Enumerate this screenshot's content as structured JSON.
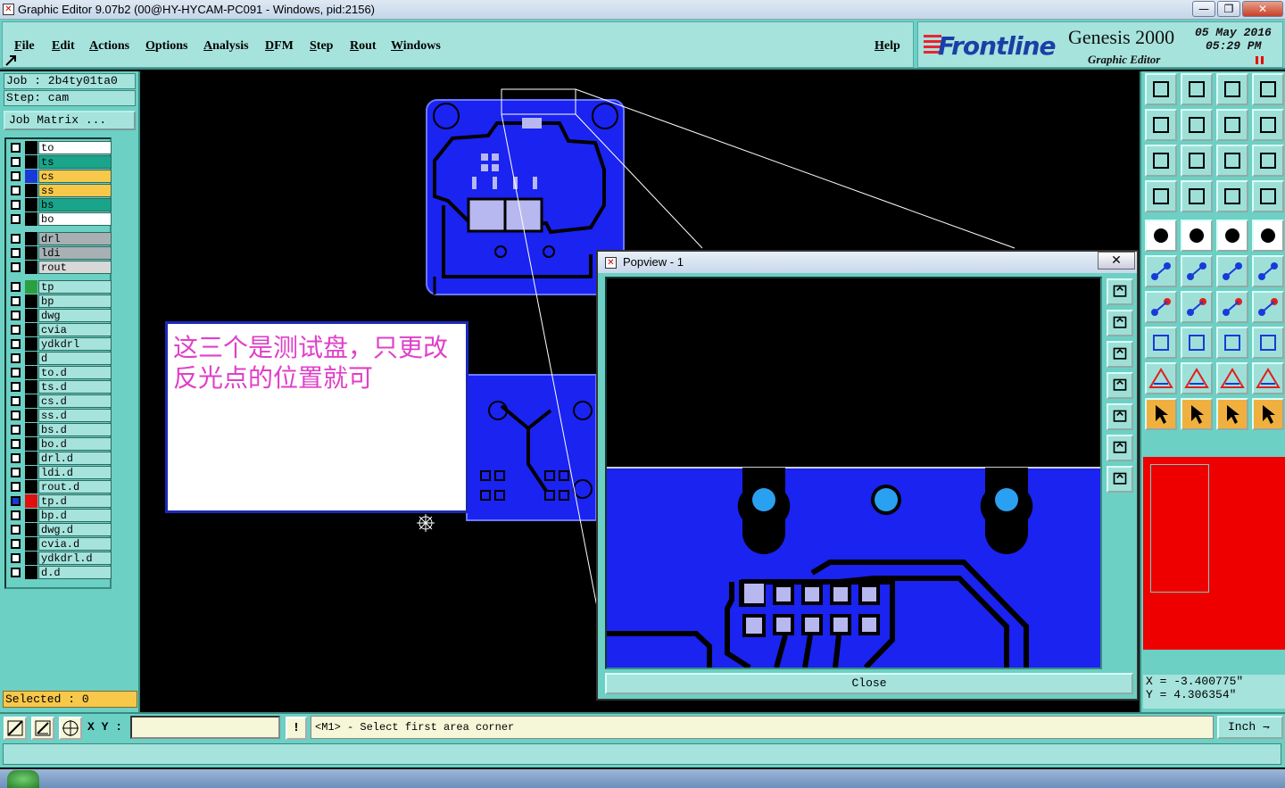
{
  "window": {
    "title": "Graphic Editor 9.07b2 (00@HY-HYCAM-PC091 - Windows, pid:2156)",
    "min": "—",
    "max": "❐",
    "close": "✕"
  },
  "menu": {
    "file": "File",
    "edit": "Edit",
    "actions": "Actions",
    "options": "Options",
    "analysis": "Analysis",
    "dfm": "DFM",
    "step": "Step",
    "rout": "Rout",
    "windows": "Windows",
    "help": "Help"
  },
  "logo": {
    "brand": "Frontline",
    "product": "Genesis 2000",
    "subtitle": "Graphic Editor",
    "date": "05 May 2016",
    "time": "05:29 PM"
  },
  "job": {
    "job": "Job : 2b4ty01ta0",
    "step": "Step: cam",
    "matrix": "Job Matrix ..."
  },
  "layers": [
    {
      "name": "to",
      "color": "#ffffff",
      "swatch": "#000000",
      "checked": false
    },
    {
      "name": "ts",
      "color": "#1aa58a",
      "swatch": "#000000",
      "checked": false
    },
    {
      "name": "cs",
      "color": "#f7c84a",
      "swatch": "#1a3ad8",
      "checked": false
    },
    {
      "name": "ss",
      "color": "#f7c84a",
      "swatch": "#000000",
      "checked": false
    },
    {
      "name": "bs",
      "color": "#1aa58a",
      "swatch": "#000000",
      "checked": false
    },
    {
      "name": "bo",
      "color": "#ffffff",
      "swatch": "#000000",
      "checked": false
    },
    {
      "name": "drl",
      "color": "#a8b0b4",
      "swatch": "#000000",
      "checked": false
    },
    {
      "name": "ldi",
      "color": "#a8b0b4",
      "swatch": "#000000",
      "checked": false
    },
    {
      "name": "rout",
      "color": "#d8d8d8",
      "swatch": "#000000",
      "checked": false
    },
    {
      "name": "tp",
      "color": "#a6e3dc",
      "swatch": "#2aa040",
      "checked": false
    },
    {
      "name": "bp",
      "color": "#a6e3dc",
      "swatch": "#000000",
      "checked": false
    },
    {
      "name": "dwg",
      "color": "#a6e3dc",
      "swatch": "#000000",
      "checked": false
    },
    {
      "name": "cvia",
      "color": "#a6e3dc",
      "swatch": "#000000",
      "checked": false
    },
    {
      "name": "ydkdrl",
      "color": "#a6e3dc",
      "swatch": "#000000",
      "checked": false
    },
    {
      "name": "d",
      "color": "#a6e3dc",
      "swatch": "#000000",
      "checked": false
    },
    {
      "name": "to.d",
      "color": "#a6e3dc",
      "swatch": "#000000",
      "checked": false
    },
    {
      "name": "ts.d",
      "color": "#a6e3dc",
      "swatch": "#000000",
      "checked": false
    },
    {
      "name": "cs.d",
      "color": "#a6e3dc",
      "swatch": "#000000",
      "checked": false
    },
    {
      "name": "ss.d",
      "color": "#a6e3dc",
      "swatch": "#000000",
      "checked": false
    },
    {
      "name": "bs.d",
      "color": "#a6e3dc",
      "swatch": "#000000",
      "checked": false
    },
    {
      "name": "bo.d",
      "color": "#a6e3dc",
      "swatch": "#000000",
      "checked": false
    },
    {
      "name": "drl.d",
      "color": "#a6e3dc",
      "swatch": "#000000",
      "checked": false
    },
    {
      "name": "ldi.d",
      "color": "#a6e3dc",
      "swatch": "#000000",
      "checked": false
    },
    {
      "name": "rout.d",
      "color": "#a6e3dc",
      "swatch": "#000000",
      "checked": false
    },
    {
      "name": "tp.d",
      "color": "#a6e3dc",
      "swatch": "#e01010",
      "checked": true
    },
    {
      "name": "bp.d",
      "color": "#a6e3dc",
      "swatch": "#000000",
      "checked": false
    },
    {
      "name": "dwg.d",
      "color": "#a6e3dc",
      "swatch": "#000000",
      "checked": false
    },
    {
      "name": "cvia.d",
      "color": "#a6e3dc",
      "swatch": "#000000",
      "checked": false
    },
    {
      "name": "ydkdrl.d",
      "color": "#a6e3dc",
      "swatch": "#000000",
      "checked": false
    },
    {
      "name": "d.d",
      "color": "#a6e3dc",
      "swatch": "#000000",
      "checked": false
    }
  ],
  "selected": "Selected : 0",
  "note": "这三个是测试盘，只更改反光点的位置就可",
  "popview": {
    "title": "Popview - 1",
    "close_x": "✕",
    "close_button": "Close"
  },
  "coords": {
    "x": "X = -3.400775\"",
    "y": "Y = 4.306354\""
  },
  "command": {
    "xy_label": "X Y :",
    "bang": "!",
    "prompt": "<M1> - Select first area corner",
    "units": "Inch ⇁"
  },
  "colors": {
    "panel": "#6cd0c4",
    "field": "#a6e3dc",
    "copper": "#1a23f0"
  }
}
